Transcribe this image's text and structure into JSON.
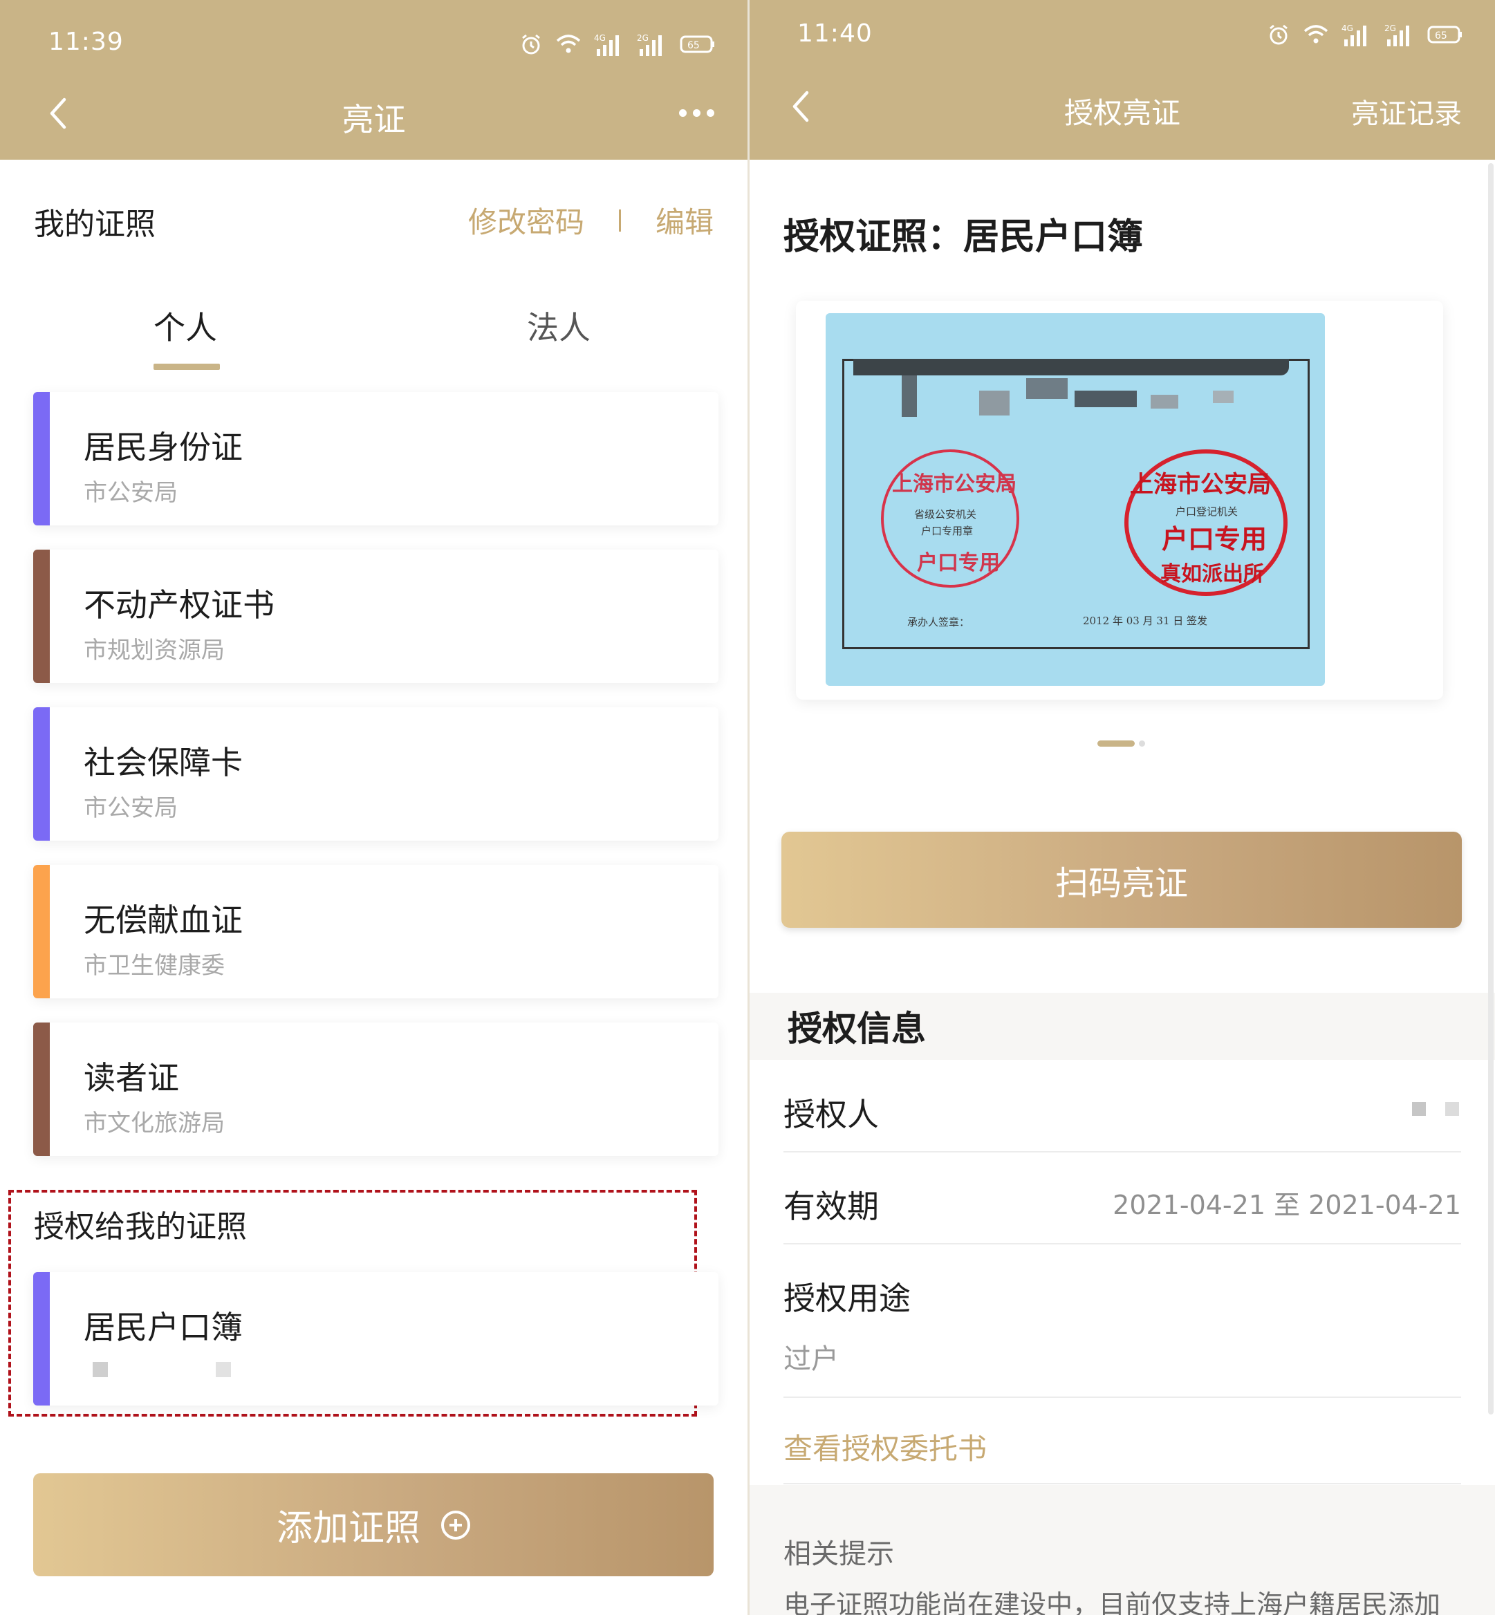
{
  "left": {
    "status": {
      "time": "11:39",
      "battery": "65"
    },
    "header": {
      "title": "亮证"
    },
    "my_certs": {
      "title": "我的证照",
      "change_password": "修改密码",
      "edit": "编辑"
    },
    "tabs": [
      {
        "label": "个人",
        "active": true
      },
      {
        "label": "法人",
        "active": false
      }
    ],
    "cards": [
      {
        "title": "居民身份证",
        "issuer": "市公安局",
        "color": "#7b6af5"
      },
      {
        "title": "不动产权证书",
        "issuer": "市规划资源局",
        "color": "#8c5a48"
      },
      {
        "title": "社会保障卡",
        "issuer": "市公安局",
        "color": "#7b6af5"
      },
      {
        "title": "无偿献血证",
        "issuer": "市卫生健康委",
        "color": "#fca34d"
      },
      {
        "title": "读者证",
        "issuer": "市文化旅游局",
        "color": "#8c5a48"
      }
    ],
    "authorized": {
      "title": "授权给我的证照",
      "card": {
        "title": "居民户口簿",
        "color": "#7b6af5"
      }
    },
    "add_button": "添加证照"
  },
  "right": {
    "status": {
      "time": "11:40",
      "battery": "65"
    },
    "header": {
      "title": "授权亮证",
      "records": "亮证记录"
    },
    "auth_cert_title": "授权证照：居民户口簿",
    "document_image": {
      "stamp_left_lines": [
        "上海市公安局",
        "省级公安机关",
        "户口专用章",
        "户口专用"
      ],
      "stamp_right_lines": [
        "上海市公安局",
        "户口登记机关",
        "户口专用",
        "真如派出所"
      ],
      "signer_label": "承办人签章：",
      "issue_date": "2012 年 03 月 31 日 签发"
    },
    "scan_button": "扫码亮证",
    "info": {
      "title": "授权信息",
      "grantor_label": "授权人",
      "validity_label": "有效期",
      "validity_value": "2021-04-21 至 2021-04-21",
      "purpose_label": "授权用途",
      "purpose_value": "过户",
      "view_letter": "查看授权委托书"
    },
    "tips": {
      "title": "相关提示",
      "body": "电子证照功能尚在建设中，目前仅支持上海户籍居民添加"
    }
  },
  "colors": {
    "header_bg": "#c9b487",
    "accent": "#c7a972",
    "dashed_box": "#b0121b"
  }
}
